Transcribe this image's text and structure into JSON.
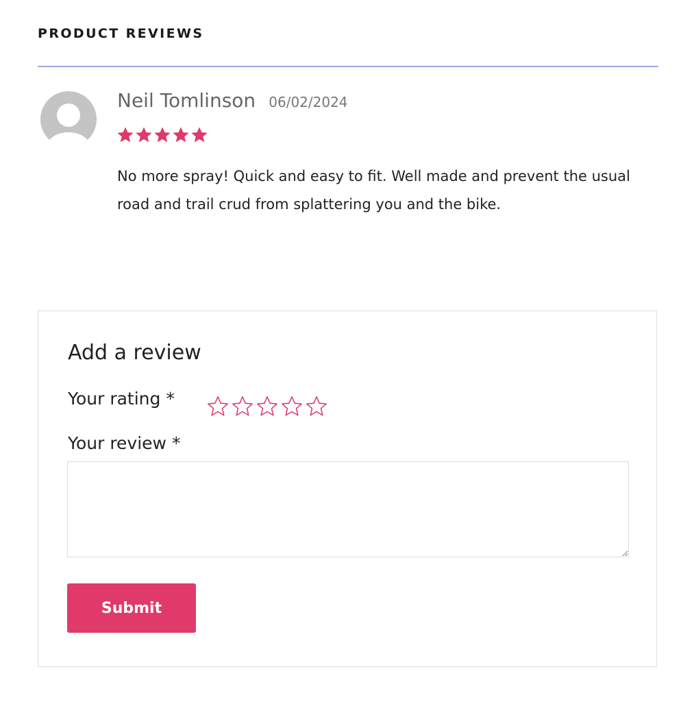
{
  "section_title": "PRODUCT REVIEWS",
  "colors": {
    "accent": "#e03a6a",
    "divider": "#9fa6d6"
  },
  "review": {
    "author": "Neil Tomlinson",
    "date": "06/02/2024",
    "rating": 5,
    "rating_max": 5,
    "text": "No more spray! Quick and easy to fit. Well made and prevent the usual road and trail crud from splattering you and the bike.",
    "avatar_icon": "default-user-avatar-icon",
    "star_icon": "filled-star-icon"
  },
  "form": {
    "title": "Add a review",
    "rating_label": "Your rating *",
    "rating_star_icon": "outline-star-icon",
    "review_label": "Your review *",
    "review_value": "",
    "submit_label": "Submit"
  }
}
